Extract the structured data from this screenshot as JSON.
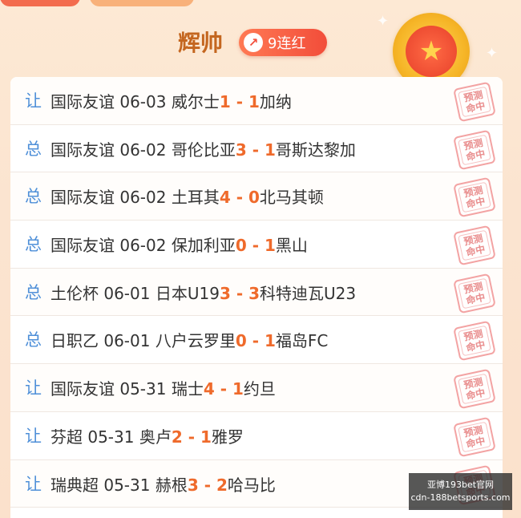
{
  "header": {
    "name": "辉帅",
    "streak_icon": "↗",
    "streak": "9连红",
    "medal_icon": "★"
  },
  "stamp_text": [
    "预测",
    "命中"
  ],
  "rows": [
    {
      "type": "让",
      "league": "国际友谊",
      "date": "06-03",
      "home": "威尔士",
      "score_home": "1",
      "sep": " - ",
      "score_away": "1",
      "away": "加纳"
    },
    {
      "type": "总",
      "league": "国际友谊",
      "date": "06-02",
      "home": "哥伦比亚",
      "score_home": "3",
      "sep": " - ",
      "score_away": "1",
      "away": "哥斯达黎加"
    },
    {
      "type": "总",
      "league": "国际友谊",
      "date": "06-02",
      "home": "土耳其",
      "score_home": "4",
      "sep": " - ",
      "score_away": "0",
      "away": "北马其顿"
    },
    {
      "type": "总",
      "league": "国际友谊",
      "date": "06-02",
      "home": "保加利亚",
      "score_home": "0",
      "sep": " - ",
      "score_away": "1",
      "away": "黑山"
    },
    {
      "type": "总",
      "league": "土伦杯",
      "date": "06-01",
      "home": "日本U19",
      "score_home": "3",
      "sep": " - ",
      "score_away": "3",
      "away": "科特迪瓦U23"
    },
    {
      "type": "总",
      "league": "日职乙",
      "date": "06-01",
      "home": "八户云罗里",
      "score_home": "0",
      "sep": " - ",
      "score_away": "1",
      "away": "福岛FC"
    },
    {
      "type": "让",
      "league": "国际友谊",
      "date": "05-31",
      "home": "瑞士",
      "score_home": "4",
      "sep": " - ",
      "score_away": "1",
      "away": "约旦"
    },
    {
      "type": "让",
      "league": "芬超",
      "date": "05-31",
      "home": "奥卢",
      "score_home": "2",
      "sep": " - ",
      "score_away": "1",
      "away": "雅罗"
    },
    {
      "type": "让",
      "league": "瑞典超",
      "date": "05-31",
      "home": "赫根",
      "score_home": "3",
      "sep": " - ",
      "score_away": "2",
      "away": "哈马比"
    }
  ],
  "watermark": {
    "line1": "亚博193bet官网",
    "line2": "cdn-188betsports.com"
  },
  "colors": {
    "accent": "#ef6a2b",
    "type": "#4e8fd8",
    "name": "#c4661f",
    "streak": "#f24d3a"
  }
}
